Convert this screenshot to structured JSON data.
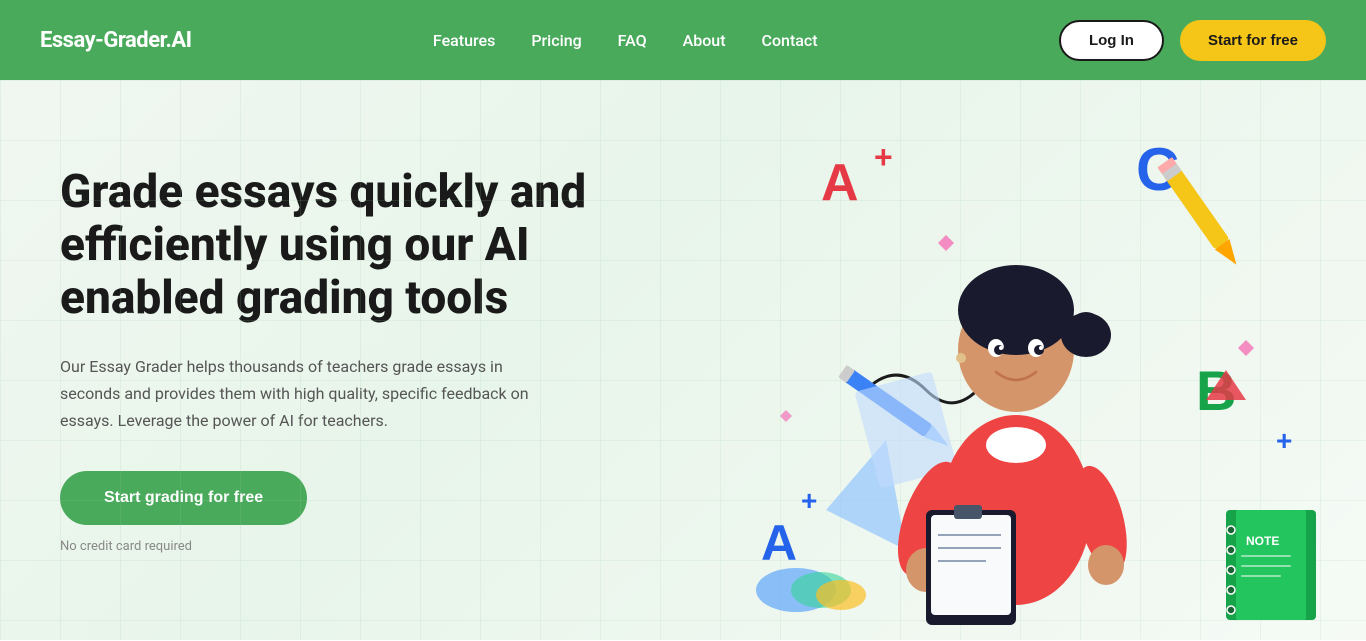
{
  "navbar": {
    "logo": "Essay-Grader.AI",
    "links": [
      {
        "id": "features",
        "label": "Features"
      },
      {
        "id": "pricing",
        "label": "Pricing"
      },
      {
        "id": "faq",
        "label": "FAQ"
      },
      {
        "id": "about",
        "label": "About"
      },
      {
        "id": "contact",
        "label": "Contact"
      }
    ],
    "login_label": "Log In",
    "start_label": "Start for free"
  },
  "hero": {
    "title": "Grade essays quickly and efficiently using our AI enabled grading tools",
    "description": "Our Essay Grader helps thousands of teachers grade essays in seconds and provides them with high quality, specific feedback on essays. Leverage the power of AI for teachers.",
    "cta_label": "Start grading for free",
    "credit_text": "No credit card required"
  }
}
